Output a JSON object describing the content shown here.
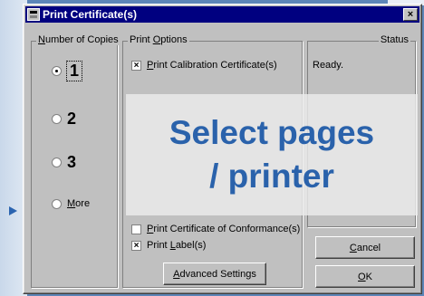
{
  "dialog": {
    "title": "Print Certificate(s)",
    "close_glyph": "×"
  },
  "copies": {
    "legend_prefix": "N",
    "legend_rest": "umber of Copies",
    "options": [
      {
        "label": "1",
        "checked": true
      },
      {
        "label": "2",
        "checked": false
      },
      {
        "label": "3",
        "checked": false
      }
    ],
    "more_first": "M",
    "more_rest": "ore"
  },
  "print_options": {
    "legend_prefix": "Print ",
    "legend_u": "O",
    "legend_rest": "ptions",
    "calibration": {
      "u": "P",
      "rest": "rint Calibration Certificate(s)",
      "checked": true,
      "mark": "×"
    },
    "conformance": {
      "u": "P",
      "rest": "rint Certificate of Conformance(s)",
      "checked": false,
      "mark": ""
    },
    "labels": {
      "pre": "Print ",
      "u": "L",
      "rest": "abel(s)",
      "checked": true,
      "mark": "×"
    },
    "advanced_button": {
      "u": "A",
      "rest": "dvanced Settings"
    }
  },
  "status": {
    "legend": "Status",
    "text": "Ready."
  },
  "buttons": {
    "cancel": {
      "u": "C",
      "rest": "ancel"
    },
    "ok": {
      "u": "O",
      "rest": "K"
    }
  },
  "overlay": {
    "line1": "Select pages",
    "line2": "/ printer",
    "color": "#2a62ab"
  }
}
